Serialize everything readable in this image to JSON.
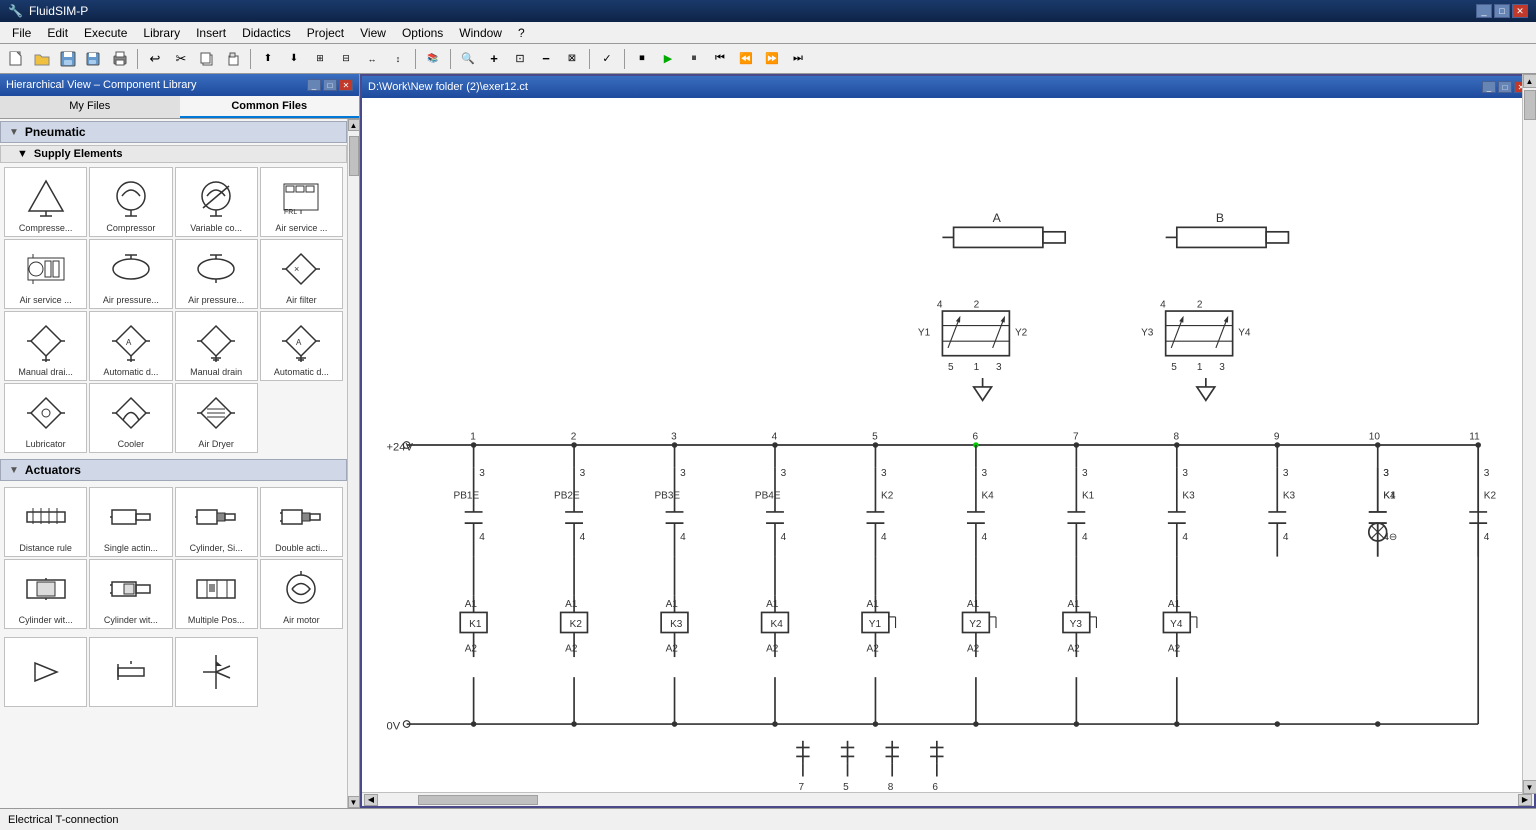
{
  "titleBar": {
    "title": "FluidSIM-P",
    "icon": "fluid-sim-icon"
  },
  "menuBar": {
    "items": [
      "File",
      "Edit",
      "Execute",
      "Library",
      "Insert",
      "Didactics",
      "Project",
      "View",
      "Options",
      "Window",
      "?"
    ]
  },
  "toolbar": {
    "buttons": [
      {
        "name": "new",
        "icon": "📄"
      },
      {
        "name": "open",
        "icon": "📂"
      },
      {
        "name": "save",
        "icon": "💾"
      },
      {
        "name": "save-special",
        "icon": "🖫"
      },
      {
        "name": "print",
        "icon": "🖨"
      },
      {
        "sep": true
      },
      {
        "name": "undo",
        "icon": "↩"
      },
      {
        "name": "cut",
        "icon": "✂"
      },
      {
        "name": "copy",
        "icon": "⧉"
      },
      {
        "name": "paste",
        "icon": "📋"
      },
      {
        "sep": true
      },
      {
        "name": "align-top",
        "icon": "⬆"
      },
      {
        "name": "align-bottom",
        "icon": "⬇"
      },
      {
        "name": "align-left",
        "icon": "⬅"
      },
      {
        "name": "align-right",
        "icon": "➡"
      },
      {
        "name": "distribute-h",
        "icon": "↔"
      },
      {
        "name": "distribute-v",
        "icon": "↕"
      },
      {
        "sep": true
      },
      {
        "name": "library",
        "icon": "📚"
      },
      {
        "sep": true
      },
      {
        "name": "zoom-window",
        "icon": "🔍"
      },
      {
        "name": "zoom-in",
        "icon": "+"
      },
      {
        "name": "zoom-fit",
        "icon": "⊡"
      },
      {
        "name": "zoom-out",
        "icon": "−"
      },
      {
        "name": "zoom-100",
        "icon": "1:1"
      },
      {
        "sep": true
      },
      {
        "name": "check",
        "icon": "✓"
      },
      {
        "sep": true
      },
      {
        "name": "stop",
        "icon": "⏹"
      },
      {
        "name": "play",
        "icon": "▶"
      },
      {
        "name": "pause",
        "icon": "⏸"
      },
      {
        "name": "rewind",
        "icon": "⏮"
      },
      {
        "name": "step-back",
        "icon": "⏪"
      },
      {
        "name": "step-fwd",
        "icon": "⏩"
      },
      {
        "name": "fast-fwd",
        "icon": "⏭"
      }
    ]
  },
  "leftPanel": {
    "title": "Hierarchical View – Component Library",
    "tabs": [
      "My Files",
      "Common Files"
    ],
    "activeTab": "Common Files",
    "categories": [
      {
        "name": "Pneumatic",
        "expanded": true,
        "subcategories": [
          {
            "name": "Supply Elements",
            "expanded": true,
            "components": [
              {
                "label": "Compresse...",
                "type": "compressor-triangle"
              },
              {
                "label": "Compressor",
                "type": "compressor-circle"
              },
              {
                "label": "Variable co...",
                "type": "variable-compressor"
              },
              {
                "label": "Air service ...",
                "type": "air-service-unit"
              },
              {
                "label": "Air service ...",
                "type": "air-service-2"
              },
              {
                "label": "Air pressure...",
                "type": "air-pressure-oval"
              },
              {
                "label": "Air pressure...",
                "type": "air-pressure-oval2"
              },
              {
                "label": "Air filter",
                "type": "air-filter-diamond"
              },
              {
                "label": "Manual drai...",
                "type": "manual-drain"
              },
              {
                "label": "Automatic d...",
                "type": "auto-drain"
              },
              {
                "label": "Manual drain",
                "type": "manual-drain2"
              },
              {
                "label": "Automatic d...",
                "type": "auto-drain2"
              },
              {
                "label": "Lubricator",
                "type": "lubricator"
              },
              {
                "label": "Cooler",
                "type": "cooler"
              },
              {
                "label": "Air Dryer",
                "type": "air-dryer"
              }
            ]
          }
        ]
      },
      {
        "name": "Actuators",
        "expanded": true,
        "subcategories": [],
        "components": [
          {
            "label": "Distance rule",
            "type": "distance-rule"
          },
          {
            "label": "Single actin...",
            "type": "single-acting"
          },
          {
            "label": "Cylinder, Si...",
            "type": "cylinder-si"
          },
          {
            "label": "Double acti...",
            "type": "double-acting"
          },
          {
            "label": "Cylinder wit...",
            "type": "cylinder-wit"
          },
          {
            "label": "Cylinder wit...",
            "type": "cylinder-wit2"
          },
          {
            "label": "Multiple Pos...",
            "type": "multiple-pos"
          },
          {
            "label": "Air motor",
            "type": "air-motor"
          }
        ]
      }
    ]
  },
  "docWindow": {
    "title": "D:\\Work\\New folder (2)\\exer12.ct",
    "scrollH": 45,
    "scrollV": 15
  },
  "statusBar": {
    "text": "Electrical T-connection"
  }
}
